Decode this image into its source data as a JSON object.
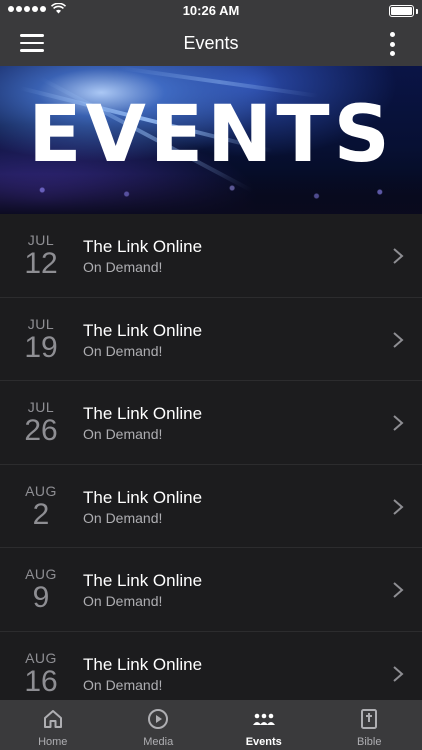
{
  "status_bar": {
    "time": "10:26 AM"
  },
  "nav": {
    "title": "Events"
  },
  "banner": {
    "text": "EVENTS"
  },
  "events": [
    {
      "month": "JUL",
      "day": "12",
      "title": "The Link Online",
      "subtitle": "On Demand!"
    },
    {
      "month": "JUL",
      "day": "19",
      "title": "The Link Online",
      "subtitle": "On Demand!"
    },
    {
      "month": "JUL",
      "day": "26",
      "title": "The Link Online",
      "subtitle": "On Demand!"
    },
    {
      "month": "AUG",
      "day": "2",
      "title": "The Link Online",
      "subtitle": "On Demand!"
    },
    {
      "month": "AUG",
      "day": "9",
      "title": "The Link Online",
      "subtitle": "On Demand!"
    },
    {
      "month": "AUG",
      "day": "16",
      "title": "The Link Online",
      "subtitle": "On Demand!"
    }
  ],
  "tabs": [
    {
      "label": "Home",
      "icon": "home-icon",
      "active": false
    },
    {
      "label": "Media",
      "icon": "play-icon",
      "active": false
    },
    {
      "label": "Events",
      "icon": "people-icon",
      "active": true
    },
    {
      "label": "Bible",
      "icon": "bible-icon",
      "active": false
    }
  ],
  "colors": {
    "bar": "#3a3a3c",
    "background": "#1c1c1e",
    "text": "#ffffff",
    "muted": "#8e8e93"
  }
}
